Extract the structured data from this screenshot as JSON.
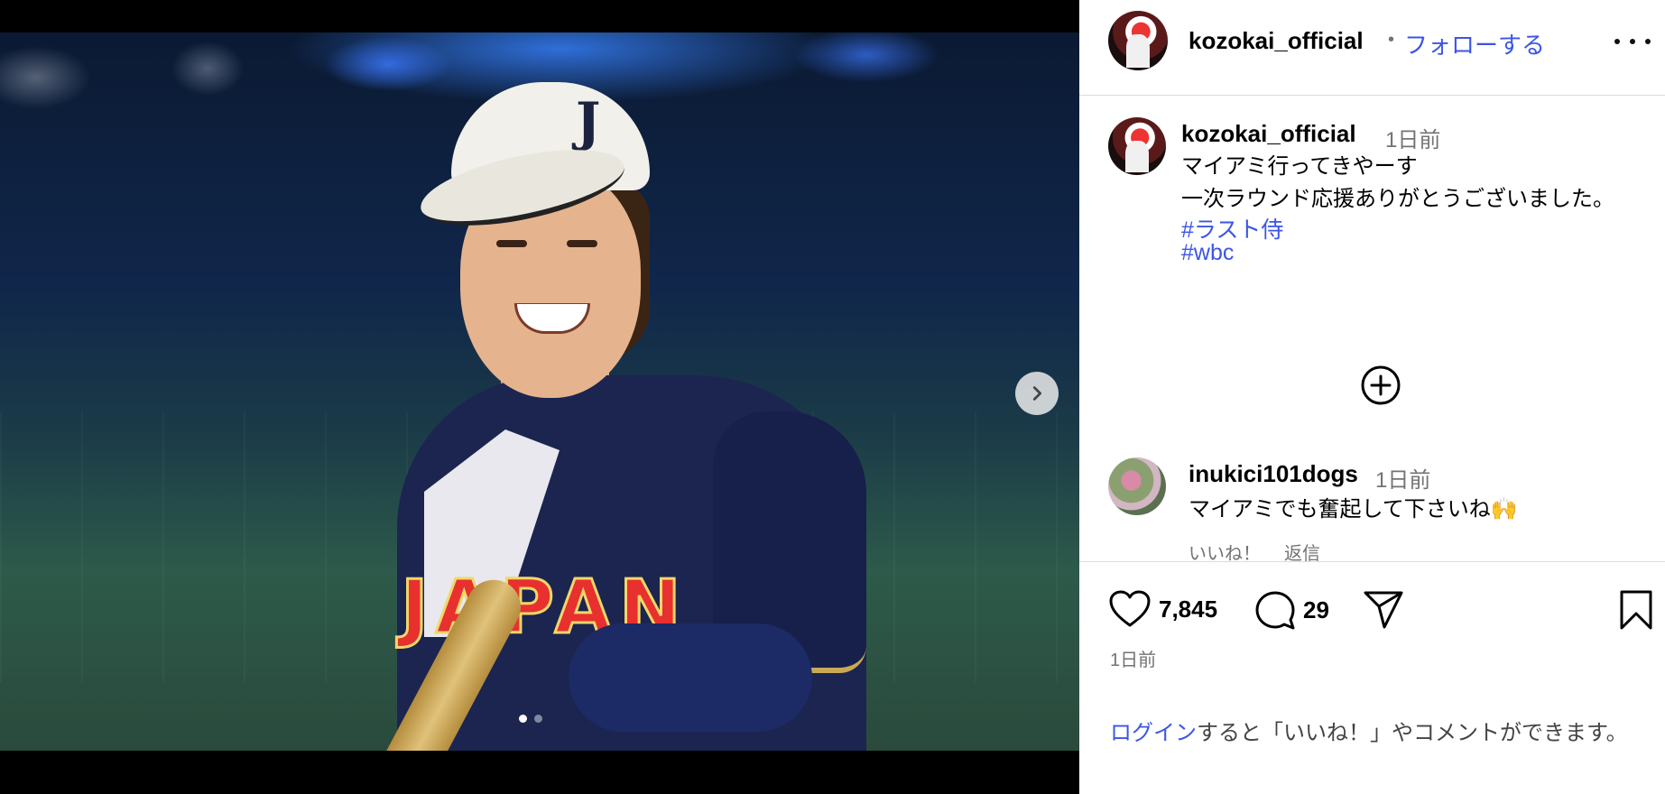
{
  "post": {
    "author": "kozokai_official",
    "follow_label": "フォローする",
    "separator": "•",
    "caption_time": "1日前",
    "caption_lines": "マイアミ行ってきやーす\n一次ラウンド応援ありがとうございました。",
    "hashtags": [
      "#ラスト侍",
      "#wbc"
    ],
    "jersey_text": "JAPAN",
    "cap_logo": "J"
  },
  "comments": [
    {
      "user": "inukici101dogs",
      "time": "1日前",
      "text": "マイアミでも奮起して下さいね🙌",
      "like_label": "いいね！",
      "reply_label": "返信"
    }
  ],
  "stats": {
    "likes": "7,845",
    "comments": "29",
    "post_time": "1日前"
  },
  "login": {
    "link_label": "ログイン",
    "rest_text": "すると「いいね！」やコメントができます。"
  },
  "carousel": {
    "total": 2,
    "current": 1
  },
  "icons": {
    "more": "more-horizontal-icon",
    "next": "chevron-right-icon",
    "load_more": "plus-circle-icon",
    "like": "heart-icon",
    "comment": "comment-icon",
    "share": "paper-plane-icon",
    "save": "bookmark-icon"
  },
  "colors": {
    "link": "#3b55e6",
    "muted": "#737373",
    "divider": "#dbdbdb"
  }
}
